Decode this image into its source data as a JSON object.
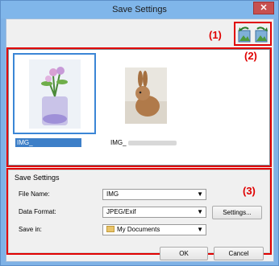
{
  "window": {
    "title": "Save Settings",
    "close_label": "✕"
  },
  "markers": {
    "one": "(1)",
    "two": "(2)",
    "three": "(3)"
  },
  "toolbar": {
    "icons": [
      "rotate-left-icon",
      "rotate-right-icon"
    ]
  },
  "thumbnails": [
    {
      "caption": "IMG_",
      "selected": true,
      "subject": "flowers-in-vase"
    },
    {
      "caption": "IMG_",
      "selected": false,
      "subject": "rabbit"
    }
  ],
  "save_settings": {
    "group_title": "Save Settings",
    "file_name_label": "File Name:",
    "file_name_value": "IMG",
    "data_format_label": "Data Format:",
    "data_format_value": "JPEG/Exif",
    "settings_button": "Settings...",
    "save_in_label": "Save in:",
    "save_in_value": "My Documents"
  },
  "footer": {
    "ok": "OK",
    "cancel": "Cancel"
  },
  "colors": {
    "accent_red": "#e00000",
    "selection_blue": "#3d7fc8",
    "titlebar": "#80b6ea",
    "close_red": "#c75050"
  }
}
